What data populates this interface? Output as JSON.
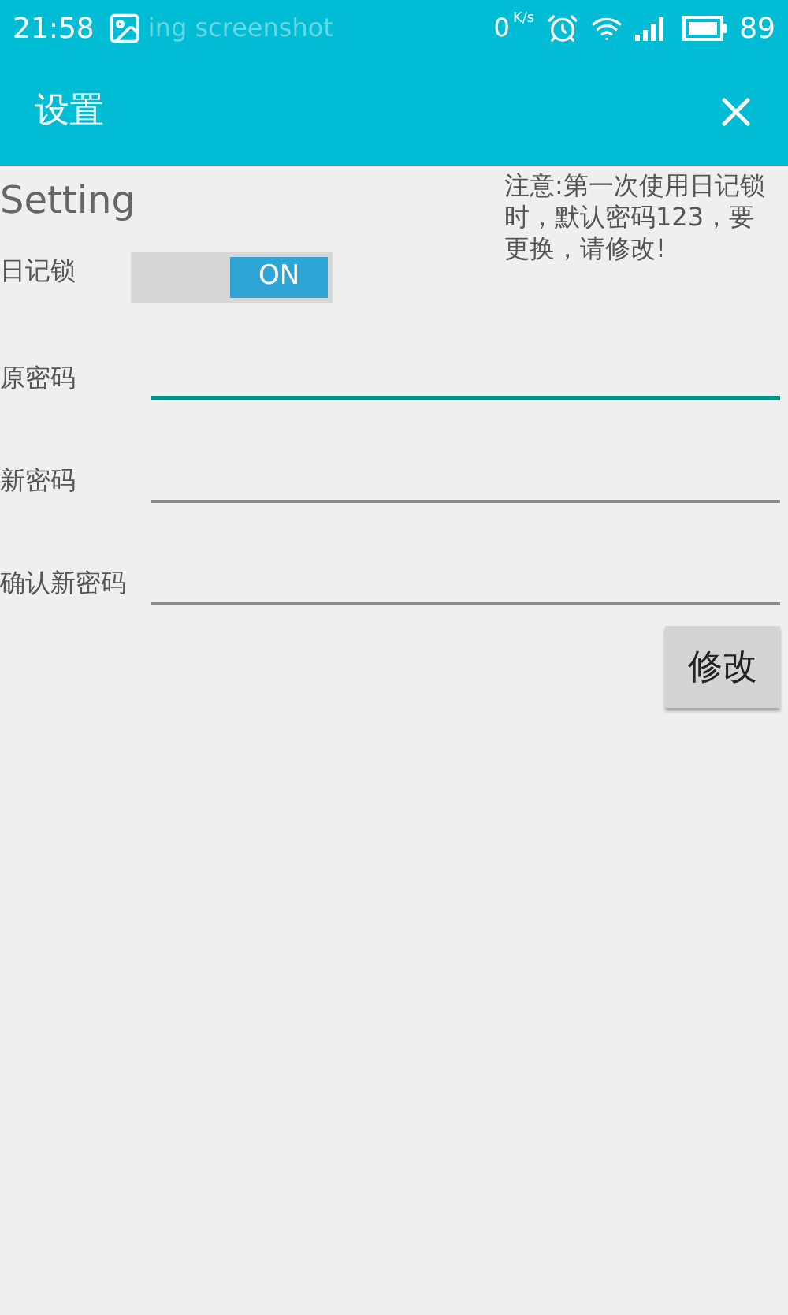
{
  "status_bar": {
    "time": "21:58",
    "ticker": "ing screenshot",
    "speed": "0",
    "speed_unit": "K/s",
    "battery": "89"
  },
  "toolbar": {
    "title": "设置"
  },
  "heading": "Setting",
  "note": "注意:第一次使用日记锁时，默认密码123，要更换，请修改!",
  "lock": {
    "label": "日记锁",
    "on": true,
    "on_text": "ON"
  },
  "fields": [
    {
      "label": "原密码",
      "focused": true
    },
    {
      "label": "新密码",
      "focused": false
    },
    {
      "label": "确认新密码",
      "focused": false
    }
  ],
  "submit": "修改"
}
